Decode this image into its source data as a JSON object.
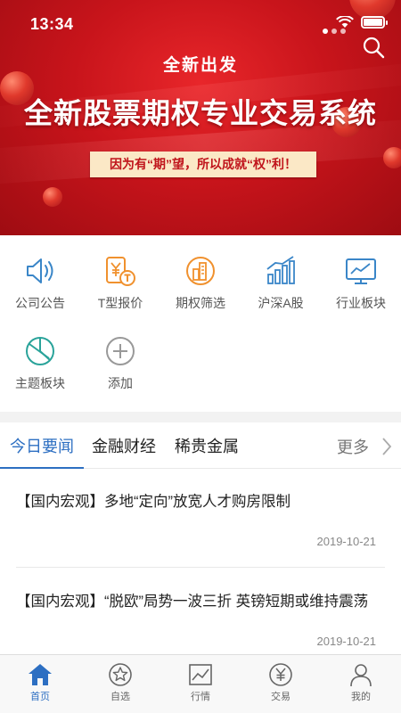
{
  "status": {
    "time": "13:34"
  },
  "banner": {
    "subtitle": "全新出发",
    "title": "全新股票期权专业交易系统",
    "slogan": "因为有“期”望，所以成就“权”利！",
    "carousel_count": 3,
    "carousel_active": 1
  },
  "quick_menu": [
    {
      "label": "公司公告",
      "icon": "speaker-icon"
    },
    {
      "label": "T型报价",
      "icon": "yen-doc-icon"
    },
    {
      "label": "期权筛选",
      "icon": "buildings-icon"
    },
    {
      "label": "沪深A股",
      "icon": "bar-trend-icon"
    },
    {
      "label": "行业板块",
      "icon": "monitor-chart-icon"
    },
    {
      "label": "主题板块",
      "icon": "pie-icon"
    },
    {
      "label": "添加",
      "icon": "plus-circle-icon"
    }
  ],
  "news": {
    "tabs": [
      "今日要闻",
      "金融财经",
      "稀贵金属"
    ],
    "active_tab": 0,
    "more_label": "更多",
    "articles": [
      {
        "title": "【国内宏观】多地“定向”放宽人才购房限制",
        "date": "2019-10-21"
      },
      {
        "title": "【国内宏观】“脱欧”局势一波三折 英镑短期或维持震荡",
        "date": "2019-10-21"
      }
    ]
  },
  "tabbar": [
    {
      "label": "首页",
      "icon": "home-icon",
      "active": true
    },
    {
      "label": "自选",
      "icon": "star-icon",
      "active": false
    },
    {
      "label": "行情",
      "icon": "chart-icon",
      "active": false
    },
    {
      "label": "交易",
      "icon": "yen-icon",
      "active": false
    },
    {
      "label": "我的",
      "icon": "user-icon",
      "active": false
    }
  ],
  "colors": {
    "accent": "#2d6fc2",
    "banner_red": "#c8141b",
    "icon_blue": "#3a86c8",
    "icon_orange": "#f0912e",
    "icon_teal": "#2aa39a"
  }
}
